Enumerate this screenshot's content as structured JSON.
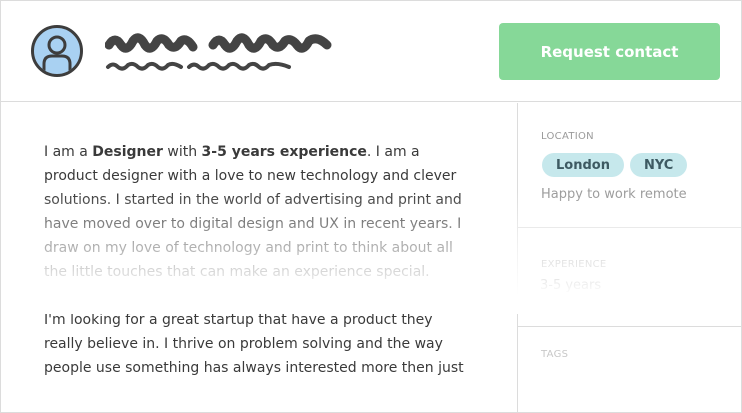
{
  "header": {
    "request_button_label": "Request contact"
  },
  "bio": {
    "p1": {
      "intro": "I am a ",
      "role": "Designer",
      "mid": " with ",
      "experience": "3-5 years experience",
      "rest": ". I am a product designer with a love to new technology and clever solutions. I started in the world of advertising and print and have moved over to digital design and UX in recent years. I draw on my love of technology and print to think about all the little touches that can make an experience special."
    },
    "p2": "I'm looking for a great startup that have a product they really believe in. I thrive on problem solving and the way people use something has always interested more then just"
  },
  "sidebar": {
    "location": {
      "label": "LOCATION",
      "cities": [
        "London",
        "NYC"
      ],
      "remote": "Happy to work remote"
    },
    "experience": {
      "label": "EXPERIENCE",
      "value": "3-5 years"
    },
    "tags": {
      "label": "TAGS"
    }
  },
  "colors": {
    "accent_button": "#86d898",
    "pill_bg": "#c6e8ec",
    "avatar_bg": "#a9d1f2",
    "border": "#dcdcdc"
  },
  "icons": {
    "avatar": "user-silhouette-icon"
  }
}
